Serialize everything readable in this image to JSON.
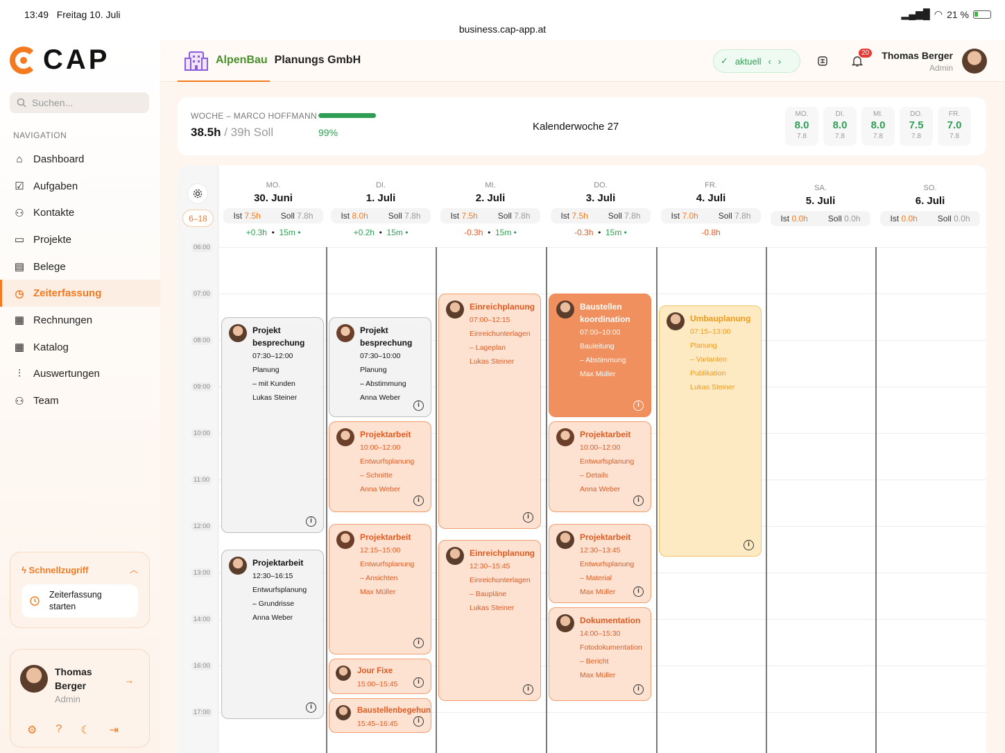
{
  "status": {
    "time": "13:49",
    "date": "Freitag 10. Juli",
    "url": "business.cap-app.at",
    "battery": "21 %"
  },
  "sidebar": {
    "logo": "CAP",
    "search_placeholder": "Suchen...",
    "nav_title": "NAVIGATION",
    "items": [
      {
        "label": "Dashboard",
        "icon": "home-icon"
      },
      {
        "label": "Aufgaben",
        "icon": "checkbox-icon"
      },
      {
        "label": "Kontakte",
        "icon": "contacts-icon"
      },
      {
        "label": "Projekte",
        "icon": "folder-icon"
      },
      {
        "label": "Belege",
        "icon": "receipt-icon"
      },
      {
        "label": "Zeiterfassung",
        "icon": "clock-icon",
        "active": true
      },
      {
        "label": "Rechnungen",
        "icon": "invoice-icon"
      },
      {
        "label": "Katalog",
        "icon": "grid-icon"
      },
      {
        "label": "Auswertungen",
        "icon": "chart-icon"
      },
      {
        "label": "Team",
        "icon": "team-icon"
      }
    ],
    "quick": {
      "title": "Schnellzugriff",
      "action": "Zeiterfassung starten"
    },
    "user": {
      "name": "Thomas Berger",
      "role": "Admin"
    }
  },
  "topbar": {
    "company_brand": "AlpenBau",
    "company_name": "Planungs GmbH",
    "week_label": "aktuell",
    "notifications": "20",
    "user_name": "Thomas Berger",
    "user_role": "Admin"
  },
  "summary": {
    "label": "WOCHE – MARCO HOFFMANN",
    "actual": "38.5h",
    "target": "/ 39h Soll",
    "percent": "99%",
    "progress": 0.99,
    "week": "Kalenderwoche 27",
    "days": [
      {
        "label": "MO.",
        "value": "8.0",
        "target": "7.8"
      },
      {
        "label": "DI.",
        "value": "8.0",
        "target": "7.8"
      },
      {
        "label": "MI.",
        "value": "8.0",
        "target": "7.8"
      },
      {
        "label": "DO.",
        "value": "7.5",
        "target": "7.8"
      },
      {
        "label": "FR.",
        "value": "7.0",
        "target": "7.8"
      }
    ]
  },
  "calendar": {
    "range": "6–18",
    "times": [
      "06:00",
      "07:00",
      "08:00",
      "09:00",
      "10:00",
      "11:00",
      "12:00",
      "13:00",
      "14:00",
      "16:00",
      "17:00"
    ],
    "days": [
      {
        "label": "MO.",
        "date": "30. Juni",
        "ist_l": "Ist",
        "ist": "7.5h",
        "soll_l": "Soll",
        "soll": "7.8h",
        "delta": "+0.3h",
        "break": "15m •",
        "delta_pos": true
      },
      {
        "label": "DI.",
        "date": "1. Juli",
        "ist_l": "Ist",
        "ist": "8.0h",
        "soll_l": "Soll",
        "soll": "7.8h",
        "delta": "+0.2h",
        "break": "15m •",
        "delta_pos": true
      },
      {
        "label": "MI.",
        "date": "2. Juli",
        "ist_l": "Ist",
        "ist": "7.5h",
        "soll_l": "Soll",
        "soll": "7.8h",
        "delta": "-0.3h",
        "break": "15m •",
        "delta_pos": false
      },
      {
        "label": "DO.",
        "date": "3. Juli",
        "ist_l": "Ist",
        "ist": "7.5h",
        "soll_l": "Soll",
        "soll": "7.8h",
        "delta": "-0.3h",
        "break": "15m •",
        "delta_pos": false
      },
      {
        "label": "FR.",
        "date": "4. Juli",
        "ist_l": "Ist",
        "ist": "7.0h",
        "soll_l": "Soll",
        "soll": "7.8h",
        "delta": "-0.8h",
        "break": "",
        "delta_pos": false
      },
      {
        "label": "SA.",
        "date": "5. Juli",
        "ist_l": "Ist",
        "ist": "0.0h",
        "soll_l": "Soll",
        "soll": "0.0h",
        "delta": "",
        "break": ""
      },
      {
        "label": "SO.",
        "date": "6. Juli",
        "ist_l": "Ist",
        "ist": "0.0h",
        "soll_l": "Soll",
        "soll": "0.0h",
        "delta": "",
        "break": ""
      }
    ],
    "events": [
      {
        "day": 0,
        "start": 7.5,
        "end": 12.2,
        "style": "grey",
        "title": "Projekt besprechung",
        "time": "07:30–12:00",
        "lines": [
          "Planung",
          "– mit Kunden",
          "Lukas Steiner"
        ]
      },
      {
        "day": 0,
        "start": 12.5,
        "end": 16.2,
        "style": "grey",
        "title": "Projektarbeit",
        "time": "12:30–16:15",
        "lines": [
          "Entwurfsplanung",
          "– Grundrisse",
          "Anna Weber"
        ]
      },
      {
        "day": 1,
        "start": 7.5,
        "end": 9.7,
        "style": "grey",
        "avatar": "f",
        "title": "Projekt besprechung",
        "time": "07:30–10:00",
        "lines": [
          "Planung",
          "– Abstimmung",
          "Anna Weber"
        ]
      },
      {
        "day": 1,
        "start": 9.75,
        "end": 11.75,
        "style": "peach",
        "avatar": "f",
        "title": "Projektarbeit",
        "time": "10:00–12:00",
        "lines": [
          "Entwurfsplanung",
          "– Schnitte",
          "Anna Weber"
        ]
      },
      {
        "day": 1,
        "start": 11.95,
        "end": 14.8,
        "style": "peach",
        "avatar": "f",
        "title": "Projektarbeit",
        "time": "12:15–15:00",
        "lines": [
          "Entwurfsplanung",
          "– Ansichten",
          "Max Müller"
        ]
      },
      {
        "day": 1,
        "start": 14.85,
        "end": 15.65,
        "style": "peach",
        "small": true,
        "title": "Jour Fixe",
        "time": "15:00–15:45",
        "lines": []
      },
      {
        "day": 1,
        "start": 15.7,
        "end": 16.5,
        "style": "peach",
        "small": true,
        "title": "Baustellenbegehung",
        "time": "15:45–16:45",
        "lines": []
      },
      {
        "day": 2,
        "start": 7.0,
        "end": 12.1,
        "style": "peach",
        "title": "Einreichplanung",
        "time": "07:00–12:15",
        "lines": [
          "Einreichunterlagen",
          "– Lageplan",
          "Lukas Steiner"
        ]
      },
      {
        "day": 2,
        "start": 12.3,
        "end": 15.8,
        "style": "peach",
        "title": "Einreichplanung",
        "time": "12:30–15:45",
        "lines": [
          "Einreichunterlagen",
          "– Baupläne",
          "Lukas Steiner"
        ]
      },
      {
        "day": 3,
        "start": 7.0,
        "end": 9.7,
        "style": "solid",
        "title": "Baustellen koordination",
        "time": "07:00–10:00",
        "lines": [
          "Bauleitung",
          "– Abstimmung",
          "Max Müller"
        ]
      },
      {
        "day": 3,
        "start": 9.75,
        "end": 11.75,
        "style": "peach",
        "avatar": "f",
        "title": "Projektarbeit",
        "time": "10:00–12:00",
        "lines": [
          "Entwurfsplanung",
          "– Details",
          "Anna Weber"
        ]
      },
      {
        "day": 3,
        "start": 11.95,
        "end": 13.7,
        "style": "peach",
        "title": "Projektarbeit",
        "time": "12:30–13:45",
        "lines": [
          "Entwurfsplanung",
          "– Material",
          "Max Müller"
        ]
      },
      {
        "day": 3,
        "start": 13.75,
        "end": 15.8,
        "style": "peach",
        "title": "Dokumentation",
        "time": "14:00–15:30",
        "lines": [
          "Fotodokumentation",
          "– Bericht",
          "Max Müller"
        ]
      },
      {
        "day": 4,
        "start": 7.25,
        "end": 12.7,
        "style": "yellow",
        "title": "Umbauplanung",
        "time": "07:15–13:00",
        "lines": [
          "Planung",
          "– Varianten",
          "Publikation",
          "Lukas Steiner"
        ]
      }
    ]
  }
}
